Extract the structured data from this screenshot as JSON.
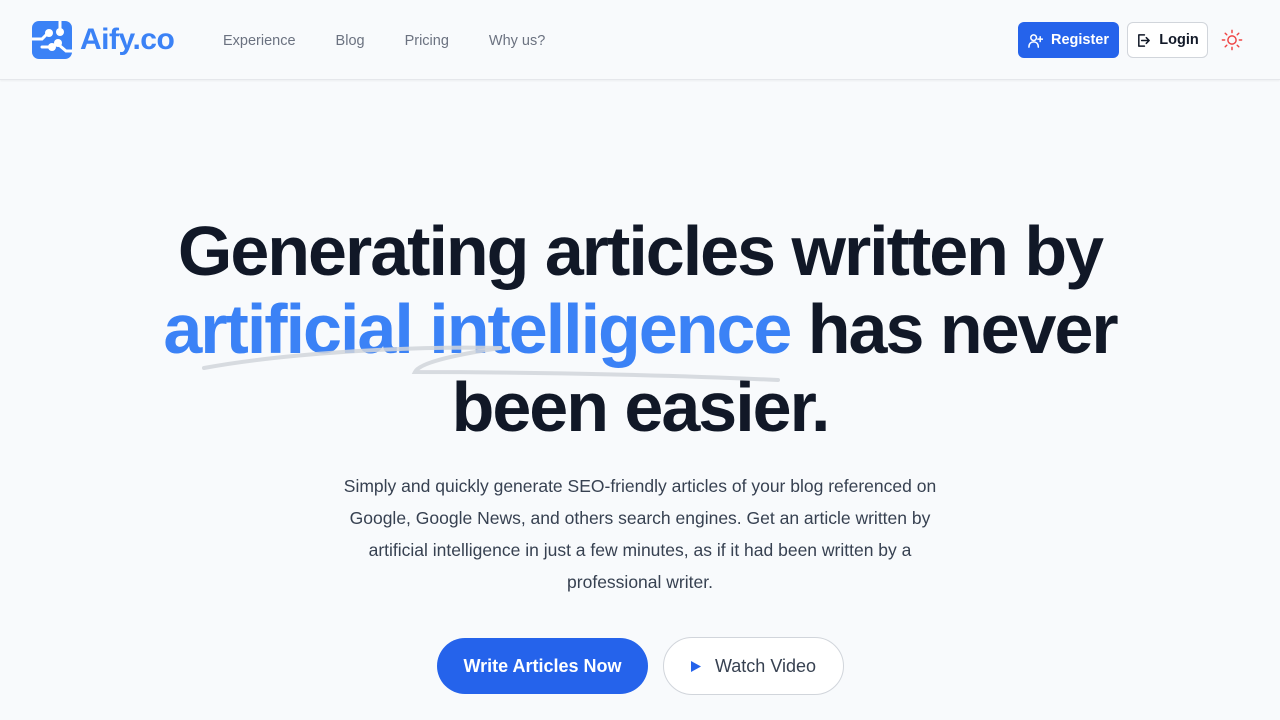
{
  "header": {
    "logo_text": "Aify.co",
    "nav": [
      {
        "label": "Experience"
      },
      {
        "label": "Blog"
      },
      {
        "label": "Pricing"
      },
      {
        "label": "Why us?"
      }
    ],
    "register_label": "Register",
    "login_label": "Login"
  },
  "hero": {
    "title_line1": "Generating articles written by",
    "title_accent": "artificial intelligence",
    "title_after_accent": " has never",
    "title_line3": "been easier.",
    "subtitle": "Simply and quickly generate SEO-friendly articles of your blog referenced on Google, Google News, and others search engines. Get an article written by artificial intelligence in just a few minutes, as if it had been written by a professional writer.",
    "primary_cta": "Write Articles Now",
    "secondary_cta": "Watch Video"
  },
  "colors": {
    "brand": "#3b82f6",
    "primary_button": "#2563eb",
    "theme_icon": "#ef4444",
    "background": "#f8fafc"
  }
}
